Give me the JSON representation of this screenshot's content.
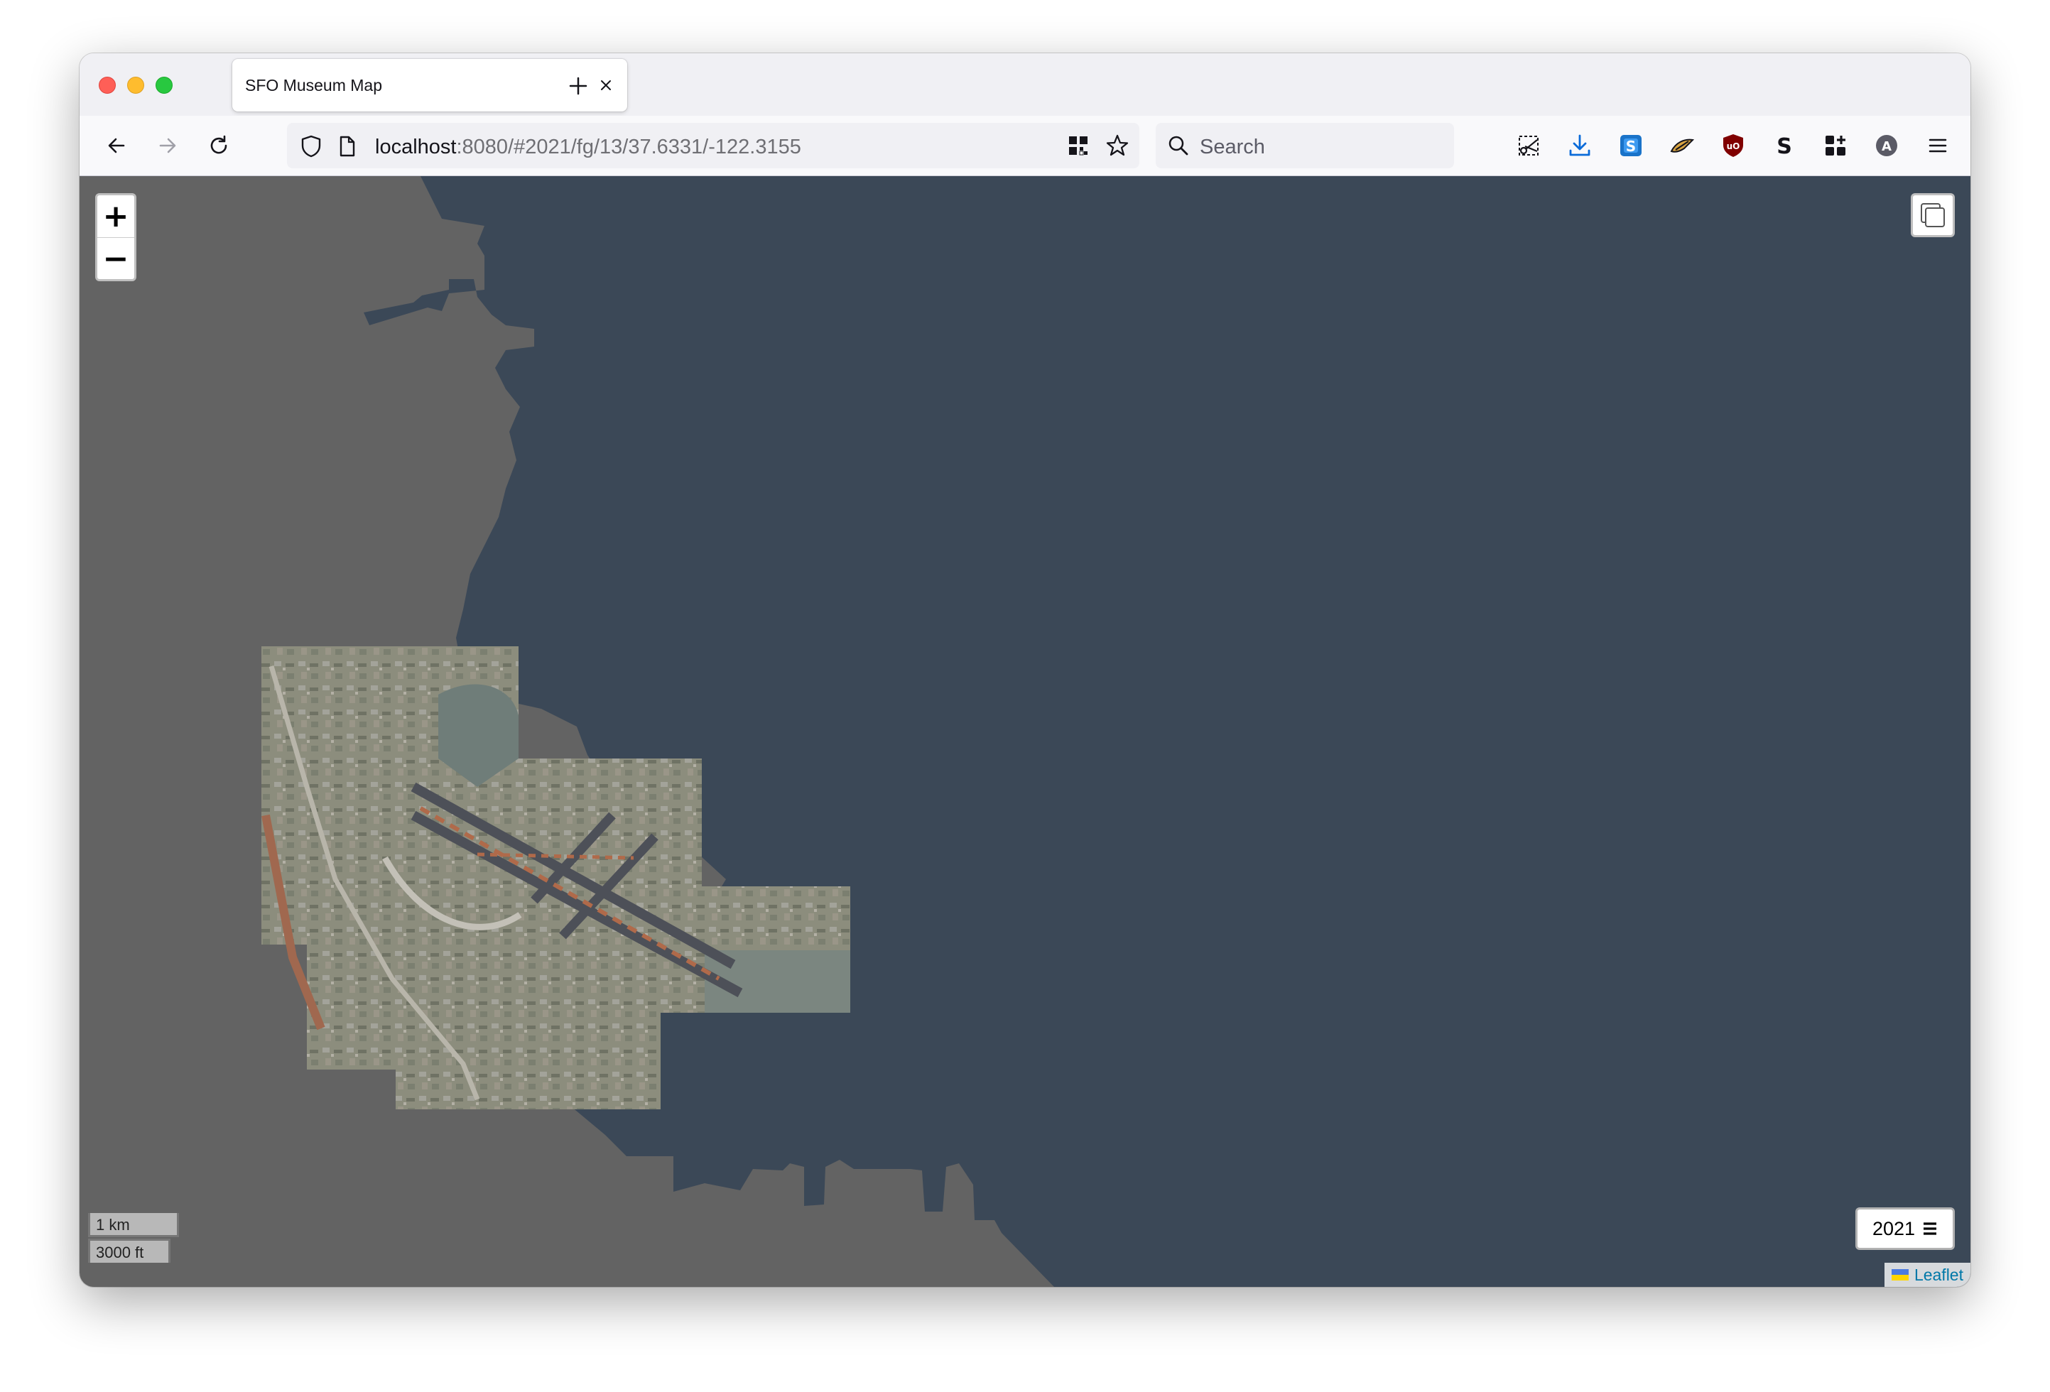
{
  "browser": {
    "tab_title": "SFO Museum Map",
    "url_host": "localhost",
    "url_rest": ":8080/#2021/fg/13/37.6331/-122.3155",
    "search_placeholder": "Search"
  },
  "map": {
    "zoom_in_label": "+",
    "zoom_out_label": "−",
    "year_label": "2021",
    "scale_metric": "1 km",
    "scale_imperial": "3000 ft",
    "attribution_link": "Leaflet",
    "colors": {
      "land": "#636363",
      "water": "#3b4857",
      "imagery": "#8a8a78",
      "runway": "#4d5058"
    }
  }
}
